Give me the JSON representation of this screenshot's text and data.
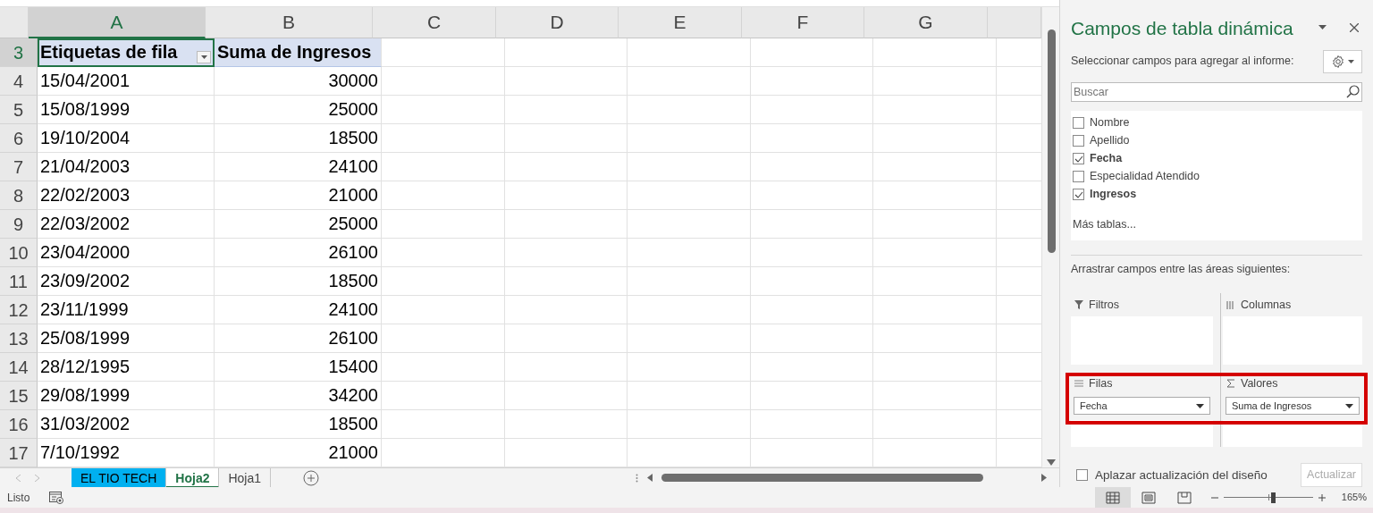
{
  "columns": [
    {
      "label": "A",
      "selected": true
    },
    {
      "label": "B",
      "selected": false
    },
    {
      "label": "C",
      "selected": false
    },
    {
      "label": "D",
      "selected": false
    },
    {
      "label": "E",
      "selected": false
    },
    {
      "label": "F",
      "selected": false
    },
    {
      "label": "G",
      "selected": false
    }
  ],
  "rows": [
    {
      "number": "3",
      "selected": true,
      "kind": "header",
      "cells": [
        "Etiquetas de fila",
        "Suma de Ingresos"
      ]
    },
    {
      "number": "4",
      "selected": false,
      "kind": "data",
      "cells": [
        "15/04/2001",
        "30000"
      ]
    },
    {
      "number": "5",
      "selected": false,
      "kind": "data",
      "cells": [
        "15/08/1999",
        "25000"
      ]
    },
    {
      "number": "6",
      "selected": false,
      "kind": "data",
      "cells": [
        "19/10/2004",
        "18500"
      ]
    },
    {
      "number": "7",
      "selected": false,
      "kind": "data",
      "cells": [
        "21/04/2003",
        "24100"
      ]
    },
    {
      "number": "8",
      "selected": false,
      "kind": "data",
      "cells": [
        "22/02/2003",
        "21000"
      ]
    },
    {
      "number": "9",
      "selected": false,
      "kind": "data",
      "cells": [
        "22/03/2002",
        "25000"
      ]
    },
    {
      "number": "10",
      "selected": false,
      "kind": "data",
      "cells": [
        "23/04/2000",
        "26100"
      ]
    },
    {
      "number": "11",
      "selected": false,
      "kind": "data",
      "cells": [
        "23/09/2002",
        "18500"
      ]
    },
    {
      "number": "12",
      "selected": false,
      "kind": "data",
      "cells": [
        "23/11/1999",
        "24100"
      ]
    },
    {
      "number": "13",
      "selected": false,
      "kind": "data",
      "cells": [
        "25/08/1999",
        "26100"
      ]
    },
    {
      "number": "14",
      "selected": false,
      "kind": "data",
      "cells": [
        "28/12/1995",
        "15400"
      ]
    },
    {
      "number": "15",
      "selected": false,
      "kind": "data",
      "cells": [
        "29/08/1999",
        "34200"
      ]
    },
    {
      "number": "16",
      "selected": false,
      "kind": "data",
      "cells": [
        "31/03/2002",
        "18500"
      ]
    },
    {
      "number": "17",
      "selected": false,
      "kind": "data",
      "cells": [
        "7/10/1992",
        "21000"
      ]
    }
  ],
  "sheet_tabs": [
    {
      "label": "EL TIO TECH",
      "selected": false,
      "color": "#00b0f0"
    },
    {
      "label": "Hoja2",
      "selected": true
    },
    {
      "label": "Hoja1",
      "selected": false
    }
  ],
  "status_bar": {
    "status": "Listo",
    "view_buttons": [
      {
        "kind": "normal",
        "selected": true
      },
      {
        "kind": "page-layout",
        "selected": false
      },
      {
        "kind": "page-break",
        "selected": false
      }
    ],
    "zoom": {
      "level": 0.55,
      "reading": "165%"
    }
  },
  "pivot_panel": {
    "title": "Campos de tabla dinámica",
    "subtitle": "Seleccionar campos para agregar al informe:",
    "search": {
      "placeholder": "Buscar"
    },
    "fields": [
      {
        "label": "Nombre",
        "checked": false
      },
      {
        "label": "Apellido",
        "checked": false
      },
      {
        "label": "Fecha",
        "checked": true
      },
      {
        "label": "Especialidad Atendido",
        "checked": false
      },
      {
        "label": "Ingresos",
        "checked": true
      }
    ],
    "more_tables": "Más tablas...",
    "areas_hint": "Arrastrar campos entre las áreas siguientes:",
    "areas": [
      {
        "kind": "filters",
        "label": "Filtros",
        "highlighted": false
      },
      {
        "kind": "columns",
        "label": "Columnas",
        "highlighted": false
      },
      {
        "kind": "rows",
        "label": "Filas",
        "highlighted": true,
        "items": [
          "Fecha"
        ]
      },
      {
        "kind": "values",
        "label": "Valores",
        "highlighted": true,
        "items": [
          "Suma de Ingresos"
        ]
      }
    ],
    "defer_update": {
      "label": "Aplazar actualización del diseño",
      "checked": false
    },
    "update_button": {
      "label": "Actualizar",
      "disabled": true
    }
  }
}
